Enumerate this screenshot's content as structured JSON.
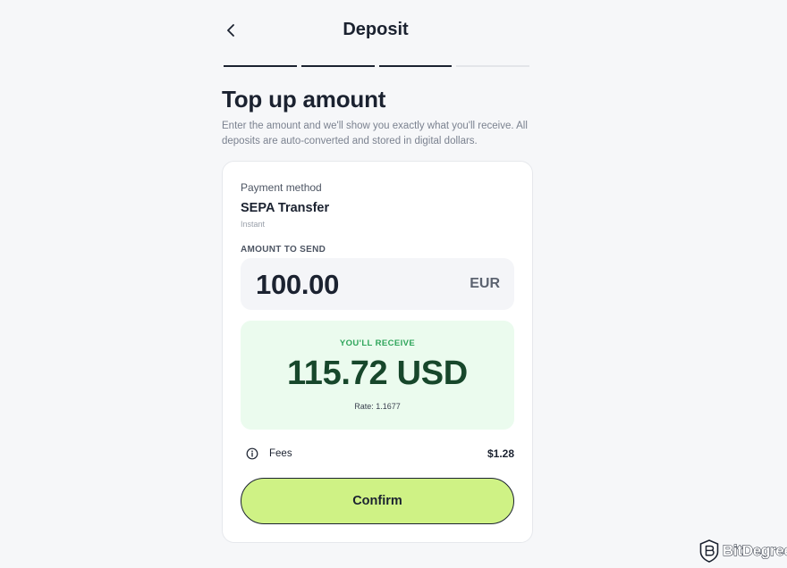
{
  "header": {
    "title": "Deposit",
    "back_icon": "chevron-left-icon"
  },
  "progress": {
    "total_steps": 4,
    "completed_steps": 3
  },
  "page": {
    "title": "Top up amount",
    "description": "Enter the amount and we'll show you exactly what you'll receive. All deposits are auto-converted and stored in digital dollars."
  },
  "payment": {
    "label": "Payment method",
    "method": "SEPA Transfer",
    "speed": "Instant"
  },
  "amount": {
    "label": "AMOUNT TO SEND",
    "value": "100.00",
    "currency": "EUR"
  },
  "receive": {
    "label": "YOU'LL RECEIVE",
    "value": "115.72 USD",
    "rate": "Rate: 1.1677"
  },
  "fees": {
    "label": "Fees",
    "value": "$1.28",
    "icon": "info-icon"
  },
  "confirm": {
    "label": "Confirm"
  },
  "watermark": {
    "text": "BitDegree"
  },
  "colors": {
    "accent": "#cff285",
    "receive_bg": "#ebfbee",
    "receive_label": "#2fa55b",
    "receive_value": "#17472b",
    "text": "#1b2230"
  }
}
